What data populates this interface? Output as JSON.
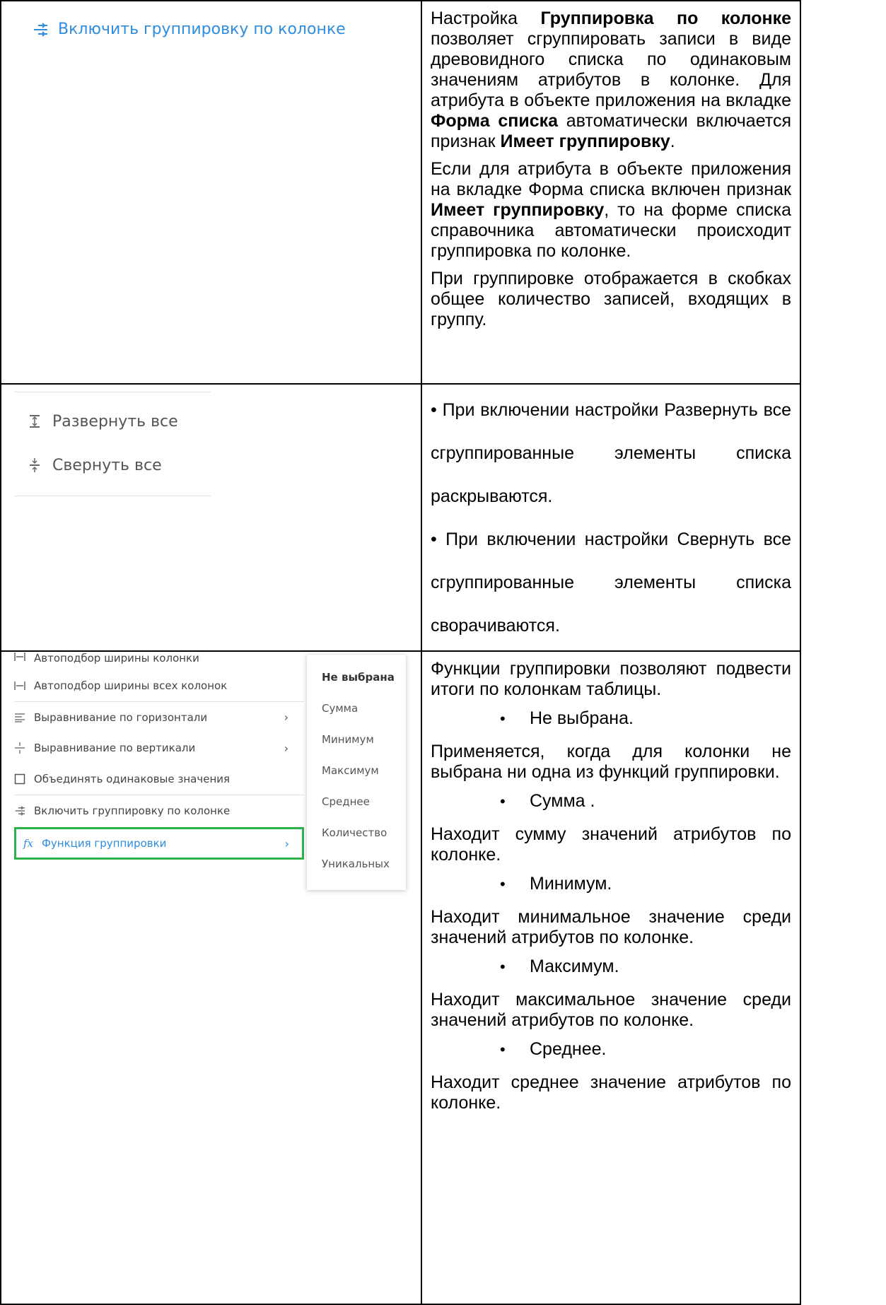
{
  "row1": {
    "toggle_label": "Включить группировку по колонке",
    "p1": {
      "t1": "Настройка ",
      "b1": "Группировка по колонке",
      "t2": " позволяет сгруппировать записи в виде древовидного списка по одинаковым значениям атрибутов в колонке. Для атрибута в объекте приложения на вкладке ",
      "b2": "Форма списка",
      "t3": " автоматически включается признак ",
      "b3": "Имеет группировку",
      "t4": "."
    },
    "p2": {
      "t1": "Если для атрибута в объекте приложения на вкладке Форма списка включен признак ",
      "b1": "Имеет группировку",
      "t2": ", то на форме списка справочника автоматически происходит группировка по колонке."
    },
    "p3": "При группировке отображается в скобках общее количество записей, входящих в группу."
  },
  "row2": {
    "expand_label": "Развернуть все",
    "collapse_label": "Свернуть все",
    "p1": "• При включении настройки Развернуть все сгруппированные элементы списка раскрываются.",
    "p2": "• При включении настройки Свернуть все сгруппированные элементы списка сворачиваются."
  },
  "row3": {
    "menu": {
      "autofit": "Автоподбор ширины колонки",
      "autofit_all": "Автоподбор ширины всех колонок",
      "align_h": "Выравнивание по горизонтали",
      "align_v": "Выравнивание по вертикали",
      "merge": "Объединять одинаковые значения",
      "group": "Включить группировку по колонке",
      "func": "Функция группировки",
      "func_icon": "fx",
      "chevron": "›"
    },
    "submenu": [
      "Не выбрана",
      "Сумма",
      "Минимум",
      "Максимум",
      "Среднее",
      "Количество",
      "Уникальных"
    ],
    "intro": "Функции группировки позволяют подвести итоги по колонкам таблицы.",
    "b1": "Не выбрана.",
    "d1": "Применяется, когда для колонки не выбрана ни одна из функций группировки.",
    "b2": "Сумма .",
    "d2": "Находит сумму значений атрибутов по колонке.",
    "b3": "Минимум.",
    "d3": "Находит минимальное значение среди значений атрибутов по колонке.",
    "b4": "Максимум.",
    "d4": "Находит максимальное значение среди значений атрибутов по колонке.",
    "b5": "Среднее.",
    "d5": "Находит среднее значение атрибутов по колонке.",
    "bullet_glyph": "•"
  },
  "colors": {
    "link_blue": "#2f8ddf",
    "highlight_green": "#2fb24c"
  }
}
